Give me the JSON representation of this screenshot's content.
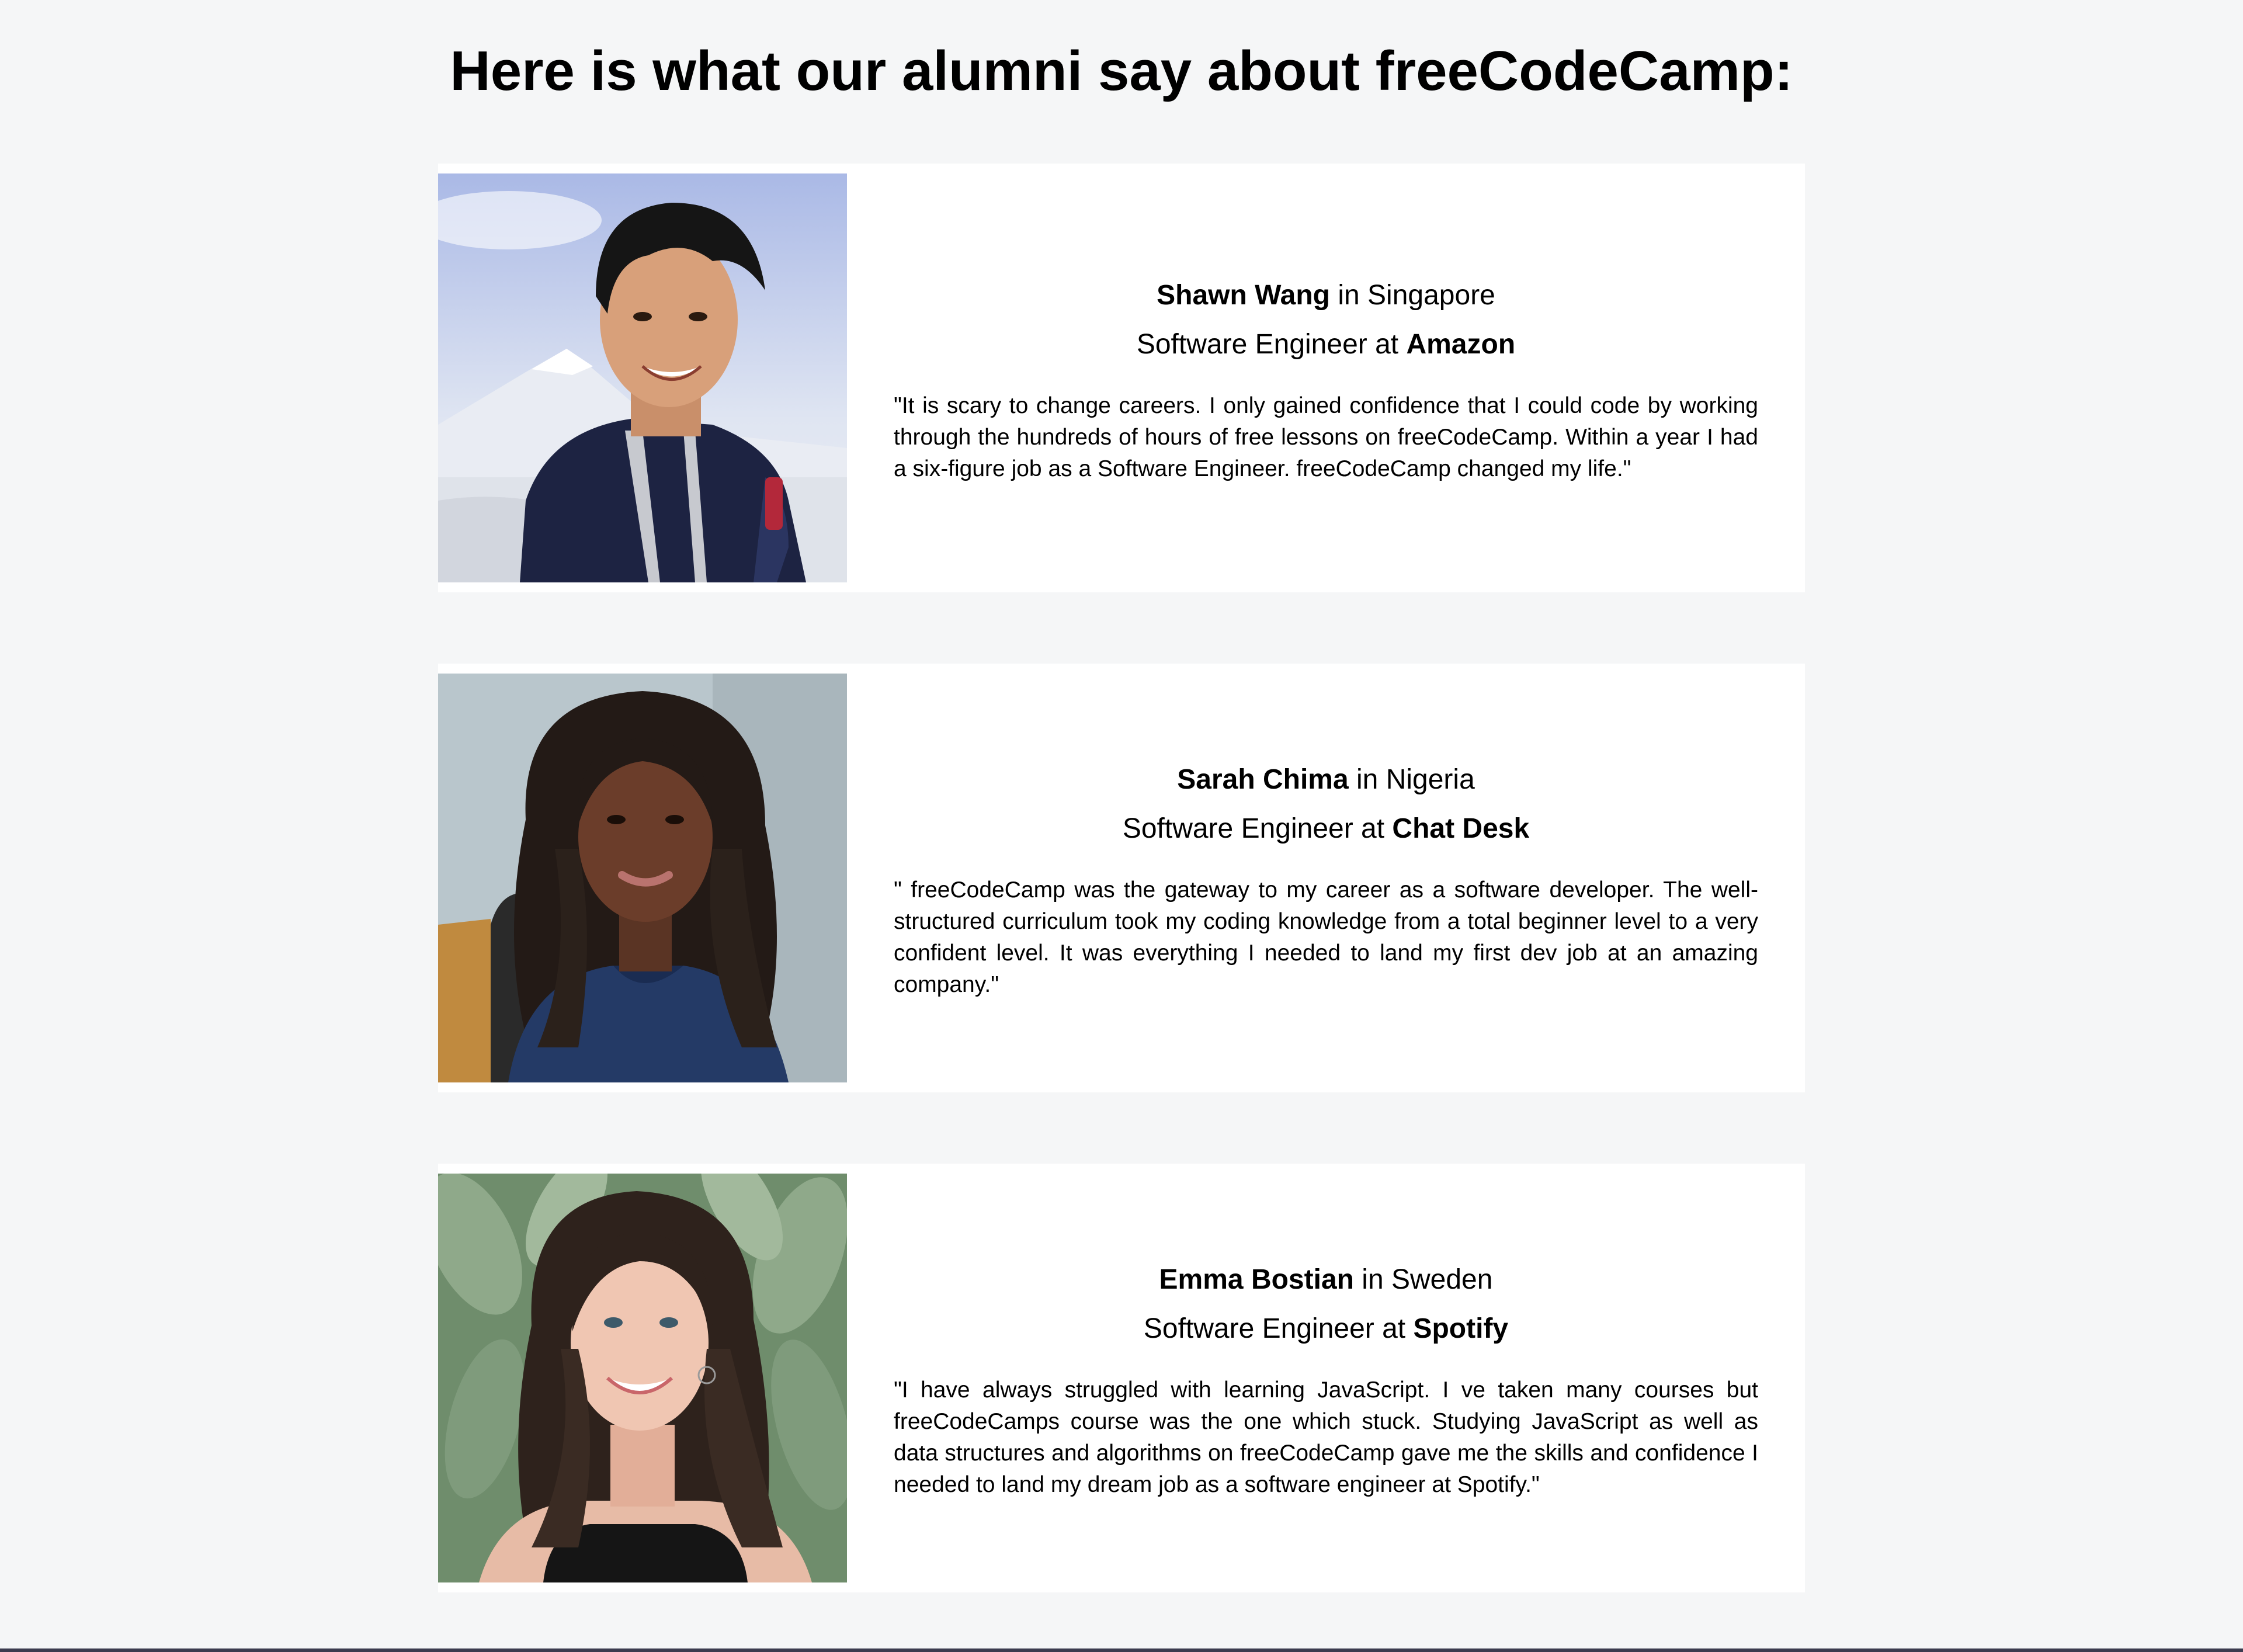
{
  "page": {
    "title": "Here is what our alumni say about freeCodeCamp:"
  },
  "testimonials": [
    {
      "name": "Shawn Wang",
      "location_prefix": " in ",
      "location": "Singapore",
      "role_prefix": "Software Engineer at ",
      "company": "Amazon",
      "quote": "\"It is scary to change careers. I only gained confidence that I could code by working through the hundreds of hours of free lessons on freeCodeCamp. Within a year I had a six-figure job as a Software Engineer. freeCodeCamp changed my life.\"",
      "photo_icon": "portrait-photo-shawn"
    },
    {
      "name": "Sarah Chima",
      "location_prefix": " in ",
      "location": "Nigeria",
      "role_prefix": "Software Engineer at ",
      "company": "Chat Desk",
      "quote": "\" freeCodeCamp was the gateway to my career as a software developer. The well-structured curriculum took my coding knowledge from a total beginner level to a very confident level. It was everything I needed to land my first dev job at an amazing company.\"",
      "photo_icon": "portrait-photo-sarah"
    },
    {
      "name": "Emma Bostian",
      "location_prefix": " in ",
      "location": "Sweden",
      "role_prefix": "Software Engineer at ",
      "company": "Spotify",
      "quote": "\"I have always struggled with learning JavaScript. I ve taken many courses but freeCodeCamps course was the one which stuck. Studying JavaScript as well as data structures and algorithms on freeCodeCamp gave me the skills and confidence I needed to land my dream job as a software engineer at Spotify.\"",
      "photo_icon": "portrait-photo-emma"
    }
  ],
  "colors": {
    "background": "#f5f6f7",
    "card": "#ffffff",
    "text": "#000000"
  }
}
